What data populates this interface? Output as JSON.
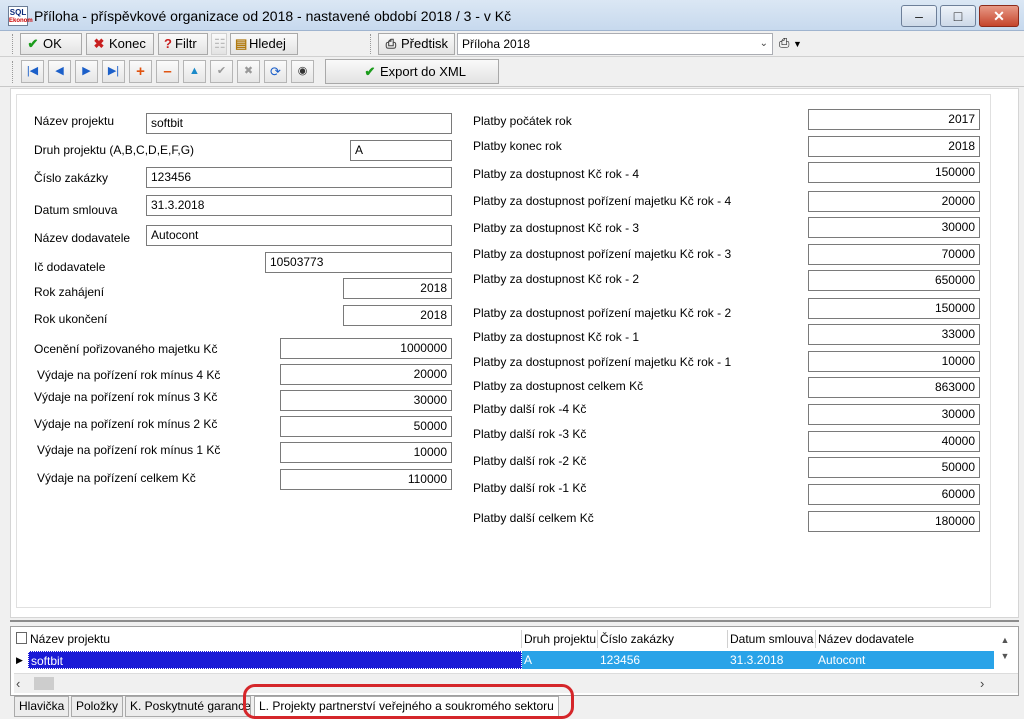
{
  "window": {
    "icon_text": "SQL",
    "icon_sub": "Ekonom",
    "title": "Příloha - příspěvkové organizace od 2018 - nastavené období 2018 / 3 - v Kč"
  },
  "toolbar": {
    "ok_label": "OK",
    "end_label": "Konec",
    "filter_label": "Filtr",
    "find_label": "Hledej",
    "print_label": "Předtisk",
    "report_select": "Příloha 2018",
    "export_label": "Export do XML"
  },
  "form_left": [
    {
      "label": "Název projektu",
      "value": "softbit"
    },
    {
      "label": "Druh projektu (A,B,C,D,E,F,G)",
      "value": "A"
    },
    {
      "label": "Číslo zakázky",
      "value": "123456"
    },
    {
      "label": "Datum smlouva",
      "value": "31.3.2018"
    },
    {
      "label": "Název dodavatele",
      "value": "Autocont"
    },
    {
      "label": "Ič dodavatele",
      "value": "10503773"
    },
    {
      "label": "Rok zahájení",
      "value": "2018"
    },
    {
      "label": "Rok ukončení",
      "value": "2018"
    },
    {
      "label": "Ocenění pořizovaného majetku Kč",
      "value": "1000000"
    },
    {
      "label": "Výdaje na pořízení rok mínus 4 Kč",
      "value": "20000"
    },
    {
      "label": "Výdaje na pořízení rok mínus 3 Kč",
      "value": "30000"
    },
    {
      "label": "Výdaje na pořízení rok mínus 2 Kč",
      "value": "50000"
    },
    {
      "label": "Výdaje na pořízení rok mínus 1 Kč",
      "value": "10000"
    },
    {
      "label": "Výdaje na pořízení celkem Kč",
      "value": "110000"
    }
  ],
  "form_right": [
    {
      "label": "Platby počátek rok",
      "value": "2017"
    },
    {
      "label": "Platby  konec rok",
      "value": "2018"
    },
    {
      "label": "Platby za dostupnost Kč rok - 4",
      "value": "150000"
    },
    {
      "label": "Platby za dostupnost pořízení majetku Kč rok - 4",
      "value": "20000"
    },
    {
      "label": "Platby za dostupnost Kč rok - 3",
      "value": "30000"
    },
    {
      "label": "Platby za dostupnost pořízení majetku Kč rok - 3",
      "value": "70000"
    },
    {
      "label": "Platby za dostupnost Kč rok - 2",
      "value": "650000"
    },
    {
      "label": "Platby za dostupnost pořízení majetku Kč rok - 2",
      "value": "150000"
    },
    {
      "label": "Platby za dostupnost Kč rok - 1",
      "value": "33000"
    },
    {
      "label": "Platby za dostupnost pořízení majetku Kč rok - 1",
      "value": "10000"
    },
    {
      "label": "Platby za dostupnost celkem Kč",
      "value": "863000"
    },
    {
      "label": "Platby další rok -4 Kč",
      "value": "30000"
    },
    {
      "label": "Platby další rok -3 Kč",
      "value": "40000"
    },
    {
      "label": "Platby další rok -2 Kč",
      "value": "50000"
    },
    {
      "label": "Platby další rok -1 Kč",
      "value": "60000"
    },
    {
      "label": "Platby další celkem Kč",
      "value": "180000"
    }
  ],
  "grid": {
    "columns": [
      "Název projektu",
      "Druh projektu",
      "Číslo zakázky",
      "Datum smlouva",
      "Název dodavatele"
    ],
    "rows": [
      [
        "softbit",
        "A",
        "123456",
        "31.3.2018",
        "Autocont"
      ]
    ]
  },
  "tabs": [
    "Hlavička",
    "Položky",
    "K. Poskytnuté garance",
    "L. Projekty partnerství veřejného a soukromého sektoru"
  ],
  "colors": {
    "selected_row": "#29a3e8",
    "selected_cell": "#1a1ad6",
    "highlight": "#d5262a"
  }
}
